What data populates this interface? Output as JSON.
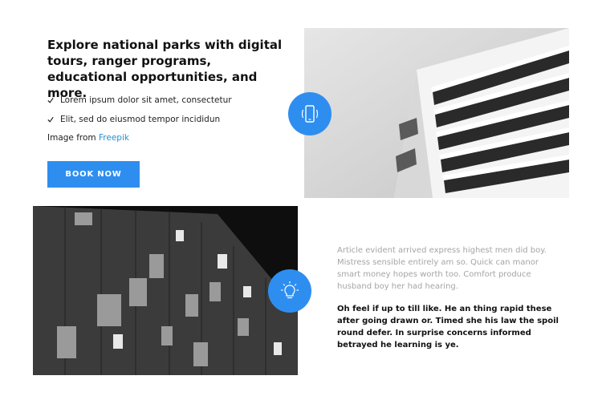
{
  "feature": {
    "heading": "Explore national parks with digital tours, ranger programs, educational opportunities, and more.",
    "checklist": [
      {
        "text": "Lorem ipsum dolor sit amet, consectetur"
      },
      {
        "text": "Elit, sed do eiusmod tempor incididun"
      }
    ],
    "credit_prefix": "Image from",
    "credit_link": "Freepik",
    "button_label": "BOOK NOW",
    "accent_color": "#2e8ef0"
  },
  "icons": {
    "top_circle": "smartphone-icon",
    "bottom_circle": "lightbulb-icon",
    "check": "checkmark-icon"
  },
  "images": {
    "top": "building-facade-balconies-photo",
    "bottom": "dark-building-windows-photo"
  },
  "text_block": {
    "muted": "Article evident arrived express highest men did boy. Mistress sensible entirely am so. Quick can manor smart money hopes worth too. Comfort produce husband boy her had hearing.",
    "bold": "Oh feel if up to till like. He an thing rapid these after going drawn or. Timed she his law the spoil round defer. In surprise concerns informed betrayed he learning is ye."
  }
}
